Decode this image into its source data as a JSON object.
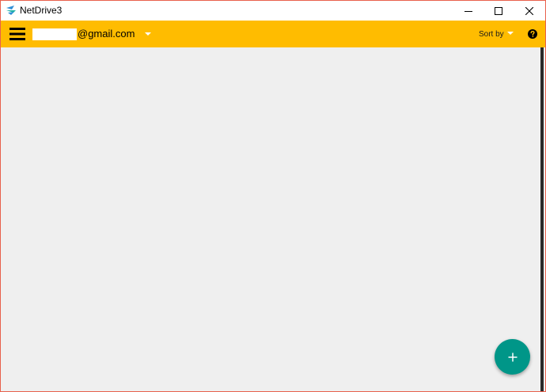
{
  "window": {
    "title": "NetDrive3"
  },
  "toolbar": {
    "account_label": "@gmail.com",
    "sort_label": "Sort by"
  },
  "colors": {
    "toolbar_bg": "#ffbc00",
    "fab_bg": "#009688",
    "content_bg": "#efefef",
    "window_border": "#e8604c"
  },
  "icons": {
    "app": "netdrive-logo-icon",
    "menu": "hamburger-menu-icon",
    "account_dropdown": "caret-down-icon",
    "sort_dropdown": "caret-down-icon",
    "help": "help-icon",
    "fab": "plus-icon",
    "minimize": "minimize-icon",
    "maximize": "maximize-icon",
    "close": "close-icon"
  }
}
